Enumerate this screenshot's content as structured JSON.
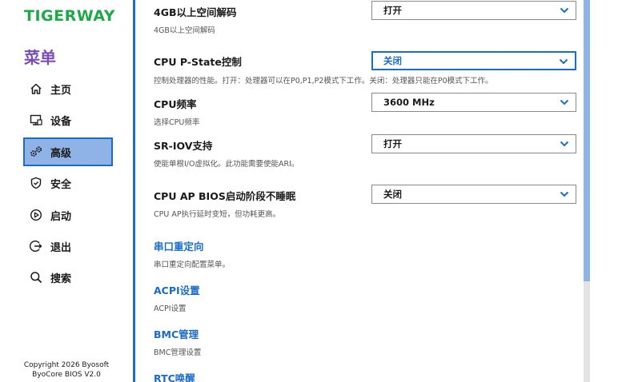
{
  "brand": {
    "logo_text": "TIGERWAY"
  },
  "sidebar": {
    "menu_title": "菜单",
    "items": [
      {
        "label": "主页",
        "icon": "home-icon"
      },
      {
        "label": "设备",
        "icon": "device-icon"
      },
      {
        "label": "高级",
        "icon": "gears-icon",
        "active": true
      },
      {
        "label": "安全",
        "icon": "shield-icon"
      },
      {
        "label": "启动",
        "icon": "play-icon"
      },
      {
        "label": "退出",
        "icon": "exit-icon"
      },
      {
        "label": "搜索",
        "icon": "search-icon"
      }
    ],
    "copyright_line1": "Copyright 2026 Byosoft",
    "copyright_line2": "ByoCore BIOS V2.0"
  },
  "settings": [
    {
      "label": "4GB以上空间解码",
      "help": "4GB以上空间解码",
      "value": "打开"
    },
    {
      "label": "CPU P-State控制",
      "help": "控制处理器的性能。打开：处理器可以在P0,P1,P2模式下工作。关闭：处理器只能在P0模式下工作。",
      "value": "关闭",
      "focused": true
    },
    {
      "label": "CPU频率",
      "help": "选择CPU频率",
      "value": "3600 MHz"
    },
    {
      "label": "SR-IOV支持",
      "help": "使能单根I/O虚拟化。此功能需要使能ARI。",
      "value": "打开"
    },
    {
      "label": "CPU AP BIOS启动阶段不睡眠",
      "help": "CPU AP执行延时变短，但功耗更高。",
      "value": "关闭"
    }
  ],
  "sections": [
    {
      "label": "串口重定向",
      "help": "串口重定向配置菜单。"
    },
    {
      "label": "ACPI设置",
      "help": "ACPI设置"
    },
    {
      "label": "BMC管理",
      "help": "BMC管理设置"
    },
    {
      "label": "RTC唤醒",
      "help": ""
    }
  ],
  "colors": {
    "accent": "#1b6cc8",
    "active_bg": "#8fb3e6",
    "logo_green": "#1ea84a",
    "menu_title_purple": "#7a4fb5"
  }
}
